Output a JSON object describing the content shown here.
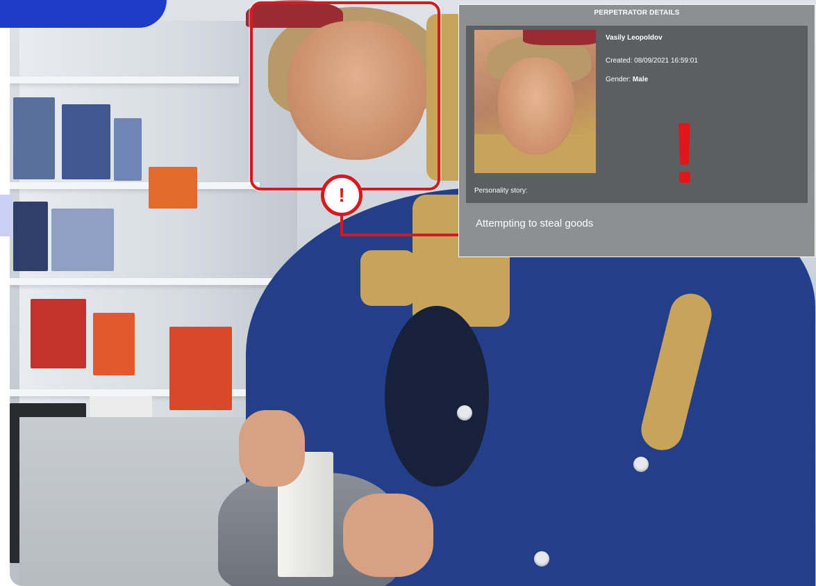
{
  "panel": {
    "title": "PERPETRATOR DETAILS",
    "name": "Vasily Leopoldov",
    "created": "Created: 08/09/2021 16:59:01",
    "gender_label": "Gender: ",
    "gender_value": "Male",
    "story_label": "Personality story:",
    "story_text": "Attempting to steal goods"
  },
  "alert": {
    "badge_symbol": "!",
    "icon": "exclamation-icon",
    "color": "#d41a1f"
  },
  "colors": {
    "accent_blue": "#1f3cc8",
    "alert_red": "#d41a1f",
    "panel_bg": "#8e8f91",
    "panel_inner_bg": "#5d5e60"
  }
}
